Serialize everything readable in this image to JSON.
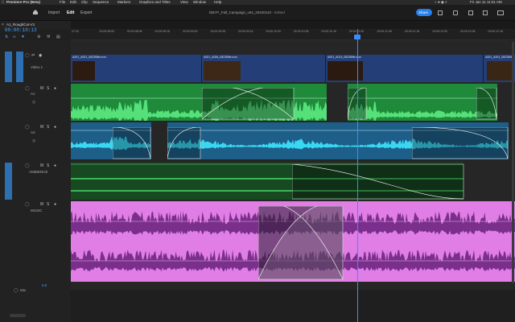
{
  "menubar": {
    "app_name": "Premiere Pro (Beta)",
    "items": [
      "File",
      "Edit",
      "Clip",
      "Sequence",
      "Markers",
      "Graphics and Titles",
      "View",
      "Window",
      "Help"
    ],
    "clock": "Fri Jan 11  11:01 AM"
  },
  "header": {
    "tabs": [
      "Import",
      "Edit",
      "Export"
    ],
    "active_tab": "Edit",
    "project_title": "DBYP_Fall_Campaign_v04_20240110",
    "status": "- Edited",
    "share_label": "Share"
  },
  "sequence": {
    "tab_label": "A1_RoughCut-V1",
    "timecode": "00:00:10:13"
  },
  "ruler": {
    "ticks": [
      "07:16",
      "00:00:08:00",
      "00:00:08:08",
      "00:00:08:16",
      "00:00:09:00",
      "00:00:09:08",
      "00:00:09:16",
      "00:00:10:00",
      "00:00:10:08",
      "00:00:10:16",
      "00:00:11:00",
      "00:00:11:08",
      "00:00:11:16",
      "00:00:12:00",
      "00:00:12:08",
      "00:00:12:16"
    ],
    "playhead_fraction": 0.645
  },
  "tracks": {
    "video_label": "Video 1",
    "a1_label": "A1",
    "a2_label": "A2",
    "ambience_label": "AMBIENCE",
    "music_label": "MUSIC",
    "mix_label": "Mix",
    "mix_value": "0.0"
  },
  "clips": {
    "video": [
      "A001_A001_08235file.mov",
      "A001_A006_08235file.mov",
      "A001_A013_08235file.mov",
      "A001_A001_08235file"
    ],
    "fx_badge": "fx"
  },
  "colors": {
    "video_clip": "#243f78",
    "dialogue": "#1e8a3a",
    "dialogue_wave": "#56e07a",
    "sfx": "#1d5f88",
    "sfx_wave": "#3ad7f2",
    "ambience": "#184a22",
    "music": "#e07ee6",
    "music_wave": "#7a2f8c",
    "playhead": "#3b8cff",
    "accent": "#2680eb"
  }
}
